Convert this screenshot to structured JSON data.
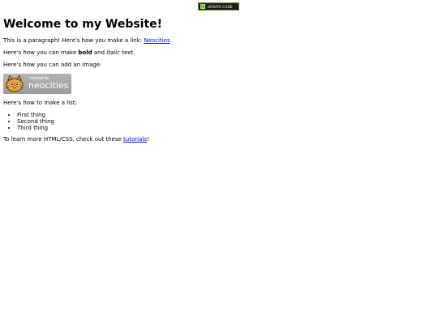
{
  "top_badge": {
    "icon": "neocities-edit-icon",
    "label": "UPDATE CODE"
  },
  "page": {
    "title": "Welcome to my Website!",
    "para1": {
      "text": "This is a paragraph! Here's how you make a link: ",
      "link": "Neocities",
      "end": "."
    },
    "para2": {
      "before": "Here's how you can make ",
      "bold": "bold",
      "middle": " and ",
      "italic": "italic",
      "after": " text."
    },
    "para3": "Here's how you can add an image:",
    "badge": {
      "hosted": "hosted by",
      "name": "neocities",
      "icon": "neocities-cat-icon",
      "colors": {
        "bg": "#a8a8a8",
        "fg": "#ffffff",
        "cat": "#f5a623"
      }
    },
    "list_intro": "Here's how to make a list:",
    "list": [
      "First thing",
      "Second thing",
      "Third thing"
    ],
    "outro": {
      "text": "To learn more HTML/CSS, check out these ",
      "link": "tutorials",
      "end": "!"
    }
  }
}
